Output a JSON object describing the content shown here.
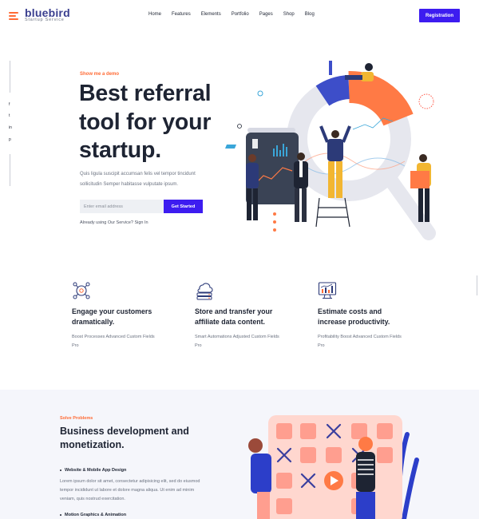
{
  "brand": {
    "name": "bluebird",
    "tagline": "Startup Service"
  },
  "nav": [
    "Home",
    "Features",
    "Elements",
    "Portfolio",
    "Pages",
    "Shop",
    "Blog"
  ],
  "header": {
    "cta_label": "Registration"
  },
  "social": [
    "f",
    "t",
    "in",
    "p"
  ],
  "hero": {
    "eyebrow": "Show me a demo",
    "title_lines": [
      "Best referral",
      "tool for your",
      "startup."
    ],
    "description": "Quis ligula suscipit accumsan felis vel tempor tincidunt sollicitudin Semper habitasse vulputate ipsum.",
    "email_placeholder": "Enter email address",
    "cta_label": "Get Started",
    "already_text": "Already using Our Service?",
    "signin_label": "Sign In"
  },
  "features": [
    {
      "icon": "network-gear-icon",
      "title": "Engage your customers dramatically.",
      "text": "Boost Processes Advanced Custom Fields Pro"
    },
    {
      "icon": "cloud-server-icon",
      "title": "Store and transfer your affiliate data content.",
      "text": "Smart Automations Adjusted Custom Fields Pro"
    },
    {
      "icon": "chart-monitor-icon",
      "title": "Estimate costs and increase productivity.",
      "text": "Profitability Boost Advanced Custom Fields Pro"
    }
  ],
  "solve": {
    "eyebrow": "Solve Problems",
    "title": "Business development and monetization.",
    "item1": "Website & Mobile App Design",
    "item1_text": "Lorem ipsum dolor sit amet, consectetur adipisicing elit, sed do eiusmod tempor incididunt ut labore et dolore magna aliqua. Ut enim ad minim veniam, quis nostrud exercitation.",
    "item2": "Motion Graphics & Animation"
  },
  "colors": {
    "accent": "#3d1cf0",
    "orange": "#ff6b35",
    "navy": "#1e2433",
    "brand": "#3a3f8f"
  }
}
